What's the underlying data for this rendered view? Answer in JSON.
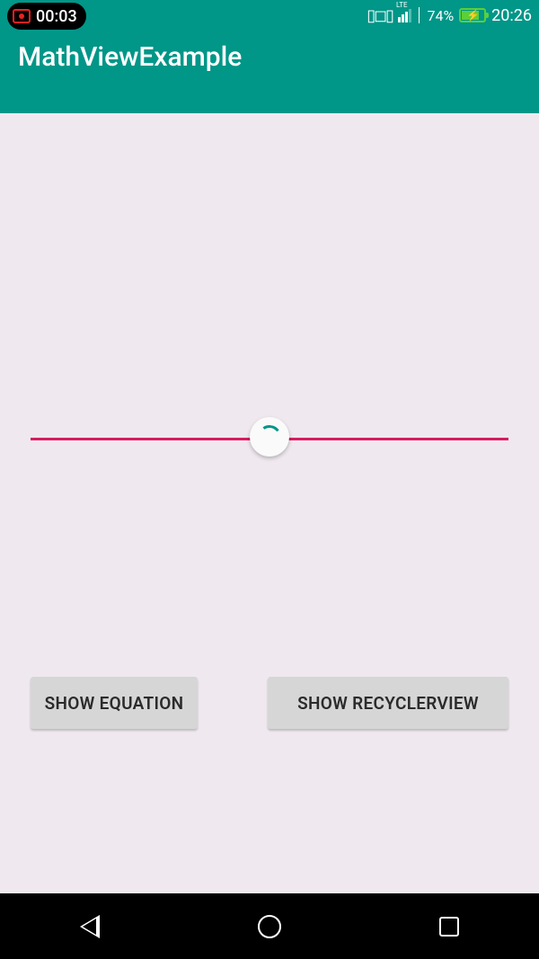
{
  "status": {
    "recording_time": "00:03",
    "battery_pct": "74%",
    "clock": "20:26",
    "network_label": "LTE"
  },
  "app_bar": {
    "title": "MathViewExample"
  },
  "buttons": {
    "show_equation": "SHOW EQUATION",
    "show_recyclerview": "SHOW RECYCLERVIEW"
  },
  "colors": {
    "primary": "#009688",
    "accent_line": "#d81b60",
    "background": "#efe9ef"
  }
}
